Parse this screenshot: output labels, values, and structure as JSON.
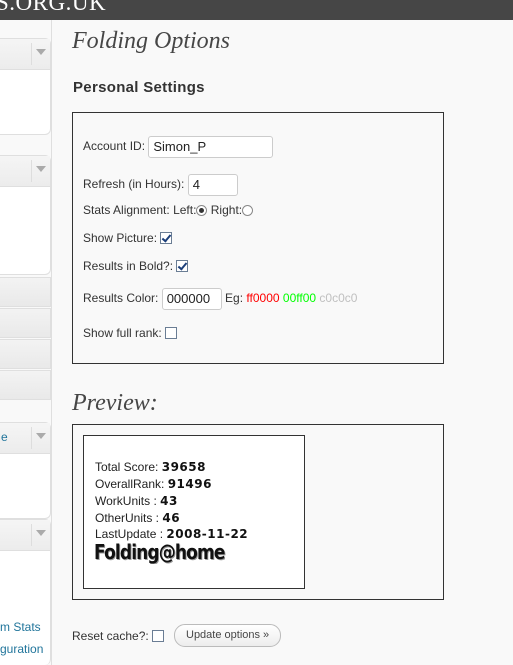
{
  "header": {
    "site_title": "S.ORG.UK"
  },
  "sidebar": {
    "partial_link_1": "e",
    "partial_link_2": "m Stats",
    "partial_link_3": "guration"
  },
  "page": {
    "title": "Folding Options",
    "section_title": "Personal Settings"
  },
  "form": {
    "account_label": "Account ID:",
    "account_value": "Simon_P",
    "refresh_label": "Refresh (in Hours):",
    "refresh_value": "4",
    "alignment_label": "Stats Alignment:",
    "alignment_left": "Left:",
    "alignment_right": "Right:",
    "alignment_selected": "Left",
    "show_picture_label": "Show Picture:",
    "show_picture_checked": true,
    "bold_label": "Results in Bold?:",
    "bold_checked": true,
    "color_label": "Results Color:",
    "color_value": "000000",
    "eg_label": "Eg:",
    "eg_red": "ff0000",
    "eg_green": "00ff00",
    "eg_grey": "c0c0c0",
    "full_rank_label": "Show full rank:",
    "full_rank_checked": false
  },
  "preview": {
    "title": "Preview:",
    "stats": [
      {
        "label": "Total Score:",
        "value": "39658"
      },
      {
        "label": "OverallRank:",
        "value": "91496"
      },
      {
        "label": "WorkUnits :",
        "value": "43"
      },
      {
        "label": "OtherUnits :",
        "value": "46"
      },
      {
        "label": "LastUpdate :",
        "value": "2008-11-22"
      }
    ],
    "logo_text": "Folding@home"
  },
  "footer": {
    "reset_label": "Reset cache?:",
    "reset_checked": false,
    "update_button": "Update options »"
  },
  "colors": {
    "topbar": "#464646",
    "link": "#21759b"
  }
}
